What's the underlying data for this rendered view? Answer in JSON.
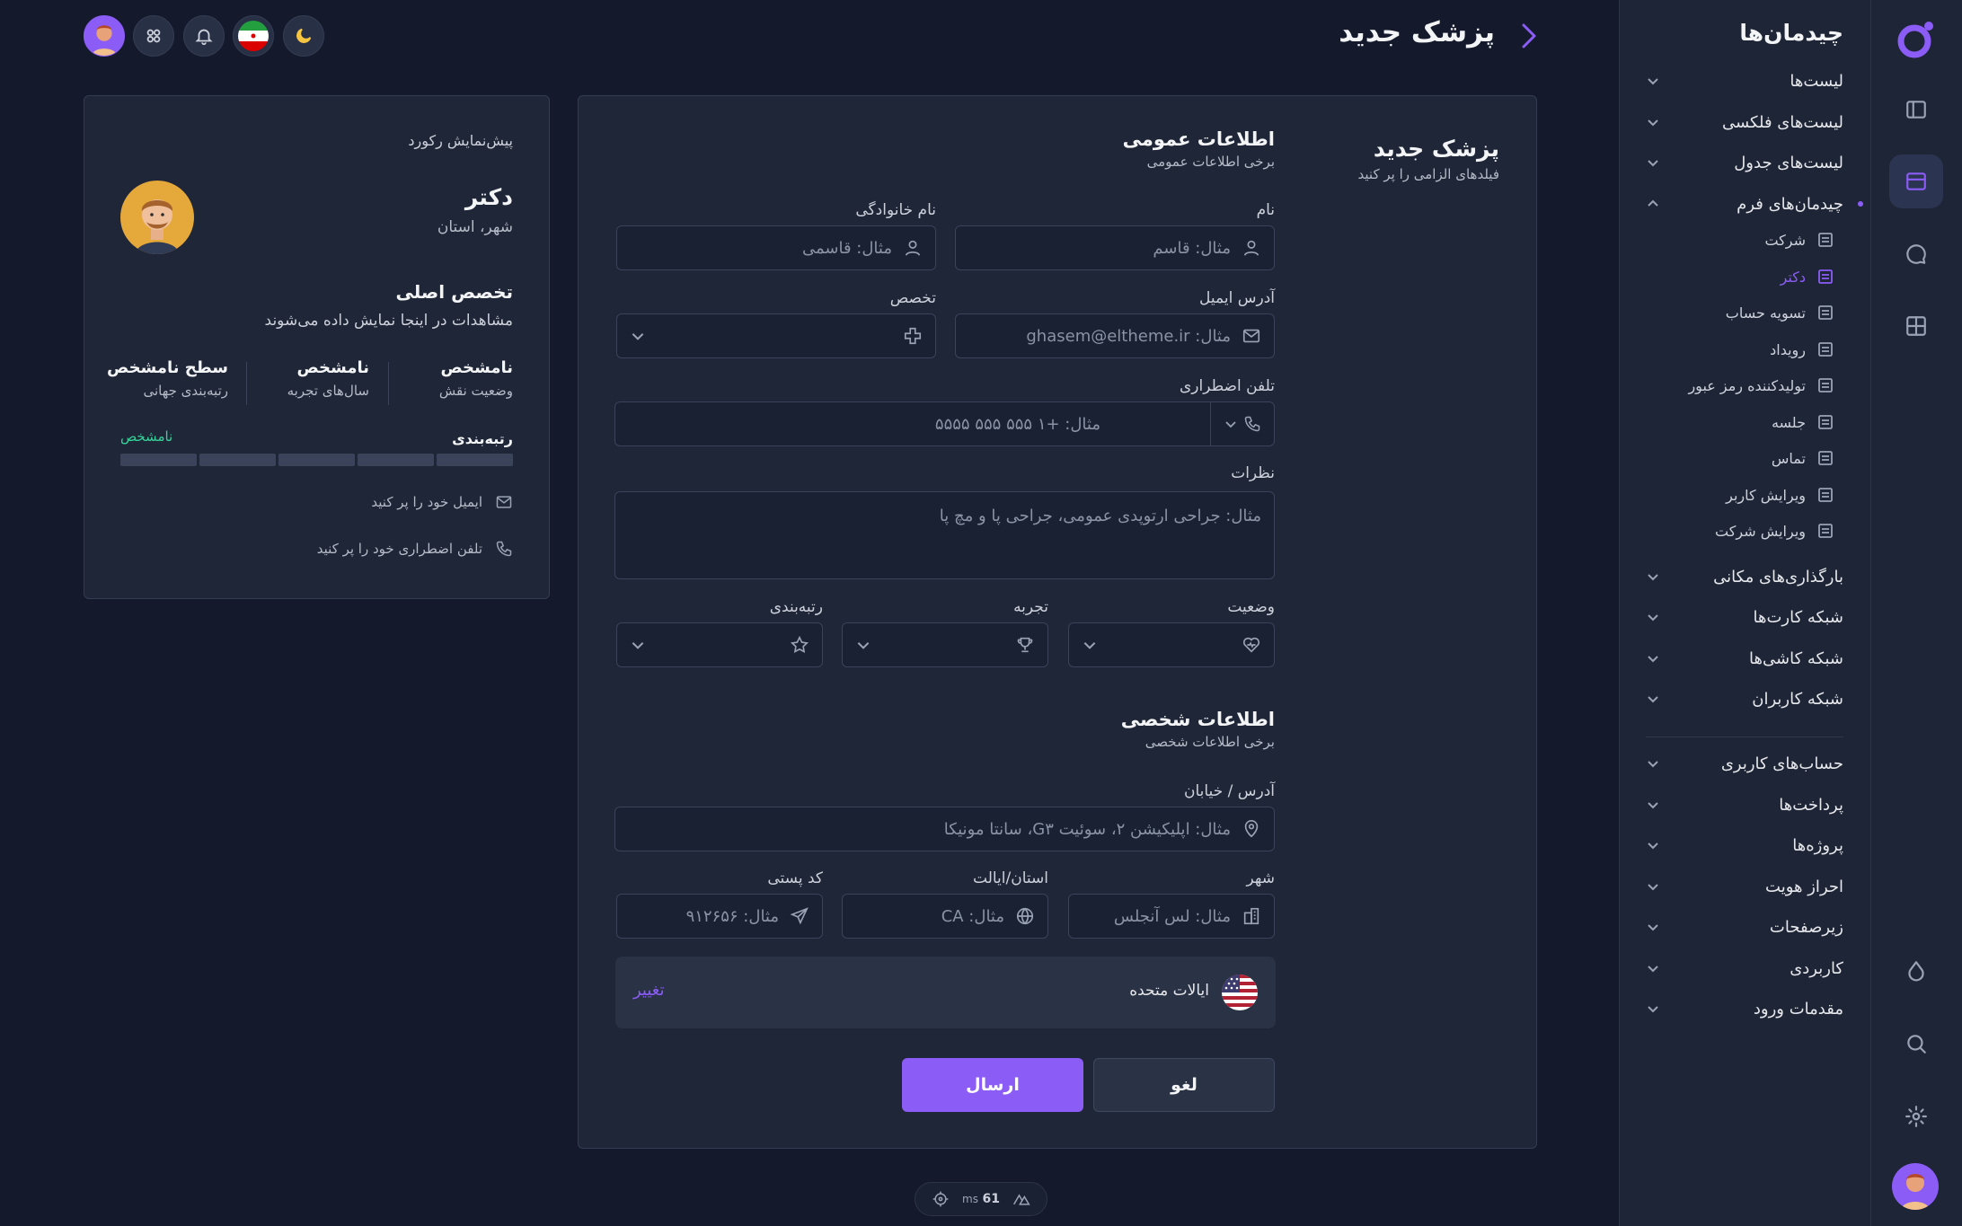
{
  "header": {
    "title": "پزشک جدید"
  },
  "menu": {
    "title": "چیدمان‌ها",
    "items": [
      {
        "label": "لیست‌ها"
      },
      {
        "label": "لیست‌های فلکسی"
      },
      {
        "label": "لیست‌های جدول"
      },
      {
        "label": "چیدمان‌های فرم"
      },
      {
        "label": "بارگذاری‌های مکانی"
      },
      {
        "label": "شبکه کارت‌ها"
      },
      {
        "label": "شبکه کاشی‌ها"
      },
      {
        "label": "شبکه کاربران"
      },
      {
        "label": "حساب‌های کاربری"
      },
      {
        "label": "پرداخت‌ها"
      },
      {
        "label": "پروژه‌ها"
      },
      {
        "label": "احراز هویت"
      },
      {
        "label": "زیرصفحات"
      },
      {
        "label": "کاربردی"
      },
      {
        "label": "مقدمات ورود"
      }
    ],
    "subitems": [
      {
        "label": "شرکت"
      },
      {
        "label": "دکتر"
      },
      {
        "label": "تسویه حساب"
      },
      {
        "label": "رویداد"
      },
      {
        "label": "تولیدکننده رمز عبور"
      },
      {
        "label": "جلسه"
      },
      {
        "label": "تماس"
      },
      {
        "label": "ویرایش کاربر"
      },
      {
        "label": "ویرایش شرکت"
      }
    ]
  },
  "form": {
    "side_title": "پزشک جدید",
    "side_subtitle": "فیلدهای الزامی را پر کنید",
    "general_title": "اطلاعات عمومی",
    "general_subtitle": "برخی اطلاعات عمومی",
    "first_name_label": "نام",
    "first_name_placeholder": "مثال: قاسم",
    "last_name_label": "نام خانوادگی",
    "last_name_placeholder": "مثال: قاسمی",
    "email_label": "آدرس ایمیل",
    "email_placeholder": "مثال: ghasem@eltheme.ir",
    "specialty_label": "تخصص",
    "phone_label": "تلفن اضطراری",
    "phone_placeholder": "مثال: +۱ ۵۵۵ ۵۵۵ ۵۵۵۵",
    "notes_label": "نظرات",
    "notes_placeholder": "مثال: جراحی ارتوپدی عمومی، جراحی پا و مچ پا",
    "status_label": "وضعیت",
    "experience_label": "تجربه",
    "rating_label": "رتبه‌بندی",
    "personal_title": "اطلاعات شخصی",
    "personal_subtitle": "برخی اطلاعات شخصی",
    "address_label": "آدرس / خیابان",
    "address_placeholder": "مثال: اپلیکیشن ۲، سوئیت G۳، سانتا مونیکا",
    "city_label": "شهر",
    "city_placeholder": "مثال: لس آنجلس",
    "state_label": "استان/ایالت",
    "state_placeholder": "مثال: CA",
    "zip_label": "کد پستی",
    "zip_placeholder": "مثال: ۹۱۲۶۵۶",
    "country": "ایالات متحده",
    "change_label": "تغییر",
    "cancel_label": "لغو",
    "submit_label": "ارسال"
  },
  "preview": {
    "label": "پیش‌نمایش رکورد",
    "name": "دکتر",
    "location": "شهر، استان",
    "specialty_title": "تخصص اصلی",
    "specialty_text": "مشاهدات در اینجا نمایش داده می‌شوند",
    "stats": [
      {
        "value": "نامشخص",
        "key": "وضعیت نقش"
      },
      {
        "value": "نامشخص",
        "key": "سال‌های تجربه"
      },
      {
        "value": "سطح نامشخص",
        "key": "رتبه‌بندی جهانی"
      }
    ],
    "rating_label": "رتبه‌بندی",
    "rating_value": "نامشخص",
    "email_hint": "ایمیل خود را پر کنید",
    "phone_hint": "تلفن اضطراری خود را پر کنید"
  },
  "perf": {
    "ms_value": "61",
    "ms_unit": "ms"
  },
  "colors": {
    "accent": "#8b5cf6",
    "background": "#141a2b",
    "panel": "#1f2637",
    "success": "#34d399"
  }
}
